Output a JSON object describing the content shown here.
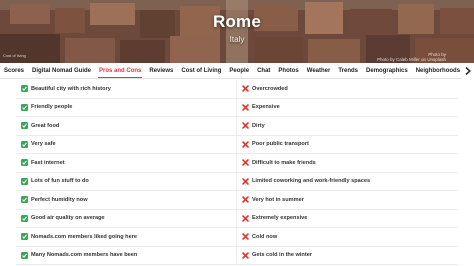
{
  "hero": {
    "city": "Rome",
    "country": "Italy",
    "credit_left": "Cost of living",
    "credit_right_line1": "Photo by",
    "credit_right_line2": "Photo by Caleb Miller on Unsplash"
  },
  "tabs": [
    {
      "label": "Scores",
      "active": false
    },
    {
      "label": "Digital Nomad Guide",
      "active": false
    },
    {
      "label": "Pros and Cons",
      "active": true
    },
    {
      "label": "Reviews",
      "active": false
    },
    {
      "label": "Cost of Living",
      "active": false
    },
    {
      "label": "People",
      "active": false
    },
    {
      "label": "Chat",
      "active": false
    },
    {
      "label": "Photos",
      "active": false
    },
    {
      "label": "Weather",
      "active": false
    },
    {
      "label": "Trends",
      "active": false
    },
    {
      "label": "Demographics",
      "active": false
    },
    {
      "label": "Neighborhoods",
      "active": false
    }
  ],
  "colors": {
    "accent": "#e6334a",
    "pro_icon": "#3aa757",
    "con_icon": "#e0362d"
  },
  "icons": {
    "pro": "check-mark-icon",
    "con": "cross-mark-icon",
    "tabs_more": "chevron-right-icon"
  },
  "pros": [
    "Beautiful city with rich history",
    "Friendly people",
    "Great food",
    "Very safe",
    "Fast internet",
    "Lots of fun stuff to do",
    "Perfect humidity now",
    "Good air quality on average",
    "Nomads.com members liked going here",
    "Many Nomads.com members have been"
  ],
  "cons": [
    "Overcrowded",
    "Expensive",
    "Dirty",
    "Poor public transport",
    "Difficult to make friends",
    "Limited coworking and work-friendly spaces",
    "Very hot in summer",
    "Extremely expensive",
    "Cold now",
    "Gets cold in the winter"
  ]
}
